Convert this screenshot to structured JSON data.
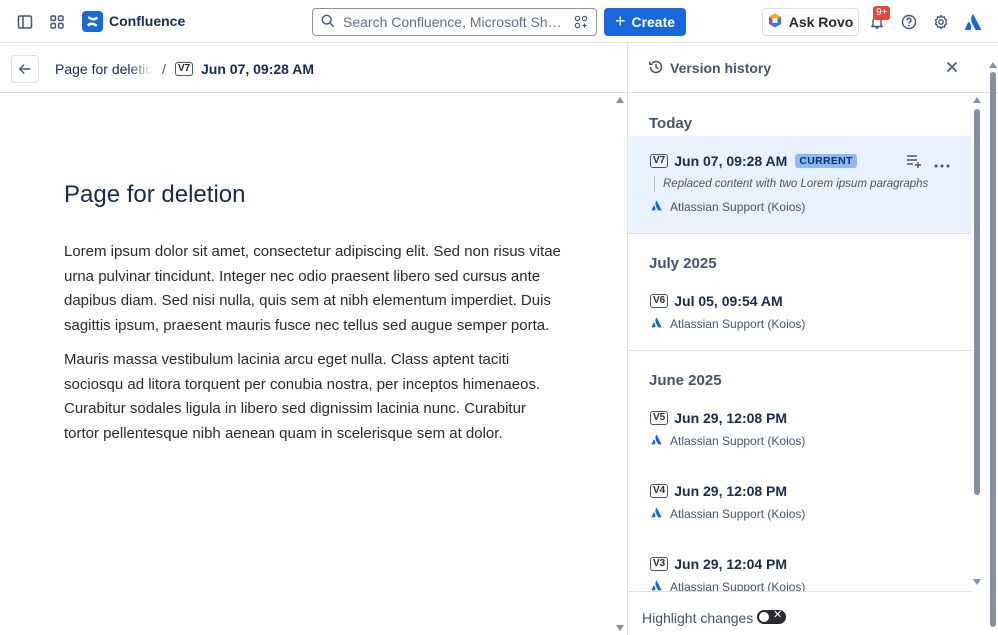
{
  "topbar": {
    "app_name": "Confluence",
    "search_placeholder": "Search Confluence, Microsoft Share...",
    "create_label": "Create",
    "rovo_label": "Ask Rovo",
    "notifications_badge": "9+",
    "brand_color": "#1868db",
    "icons": [
      "sidebar-toggle-icon",
      "app-switcher-icon",
      "confluence-logo-icon",
      "search-icon",
      "filter-icon",
      "rovo-icon",
      "bell-icon",
      "help-icon",
      "settings-icon",
      "atlassian-logo-icon"
    ]
  },
  "breadcrumb": {
    "page": "Page for deletion",
    "separator": "/",
    "version_tag": "V7",
    "version_date": "Jun 07, 09:28 AM"
  },
  "article": {
    "title": "Page for deletion",
    "paragraphs": [
      "Lorem ipsum dolor sit amet, consectetur adipiscing elit. Sed non risus vitae urna pulvinar tincidunt. Integer nec odio praesent libero sed cursus ante dapibus diam. Sed nisi nulla, quis sem at nibh elementum imperdiet. Duis sagittis ipsum, praesent mauris fusce nec tellus sed augue semper porta.",
      "Mauris massa vestibulum lacinia arcu eget nulla. Class aptent taciti sociosqu ad litora torquent per conubia nostra, per inceptos himenaeos. Curabitur sodales ligula in libero sed dignissim lacinia nunc. Curabitur tortor pellentesque nibh aenean quam in scelerisque sem at dolor."
    ]
  },
  "history": {
    "title": "Version history",
    "groups": [
      {
        "label": "Today",
        "versions": [
          {
            "tag": "V7",
            "date": "Jun 07, 09:28 AM",
            "current_label": "CURRENT",
            "description": "Replaced content with two Lorem ipsum paragraphs",
            "author": "Atlassian Support (Koios)"
          }
        ]
      },
      {
        "label": "July 2025",
        "versions": [
          {
            "tag": "V6",
            "date": "Jul 05, 09:54 AM",
            "author": "Atlassian Support (Koios)"
          }
        ]
      },
      {
        "label": "June 2025",
        "versions": [
          {
            "tag": "V5",
            "date": "Jun 29, 12:08 PM",
            "author": "Atlassian Support (Koios)"
          },
          {
            "tag": "V4",
            "date": "Jun 29, 12:08 PM",
            "author": "Atlassian Support (Koios)"
          },
          {
            "tag": "V3",
            "date": "Jun 29, 12:04 PM",
            "author": "Atlassian Support (Koios)"
          }
        ]
      }
    ],
    "footer": {
      "highlight_label": "Highlight changes",
      "highlight_enabled": false
    }
  }
}
